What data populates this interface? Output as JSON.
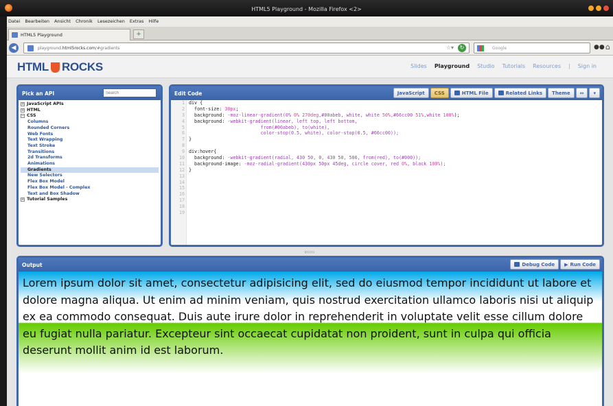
{
  "browser": {
    "title": "HTML5 Playground - Mozilla Firefox <2>",
    "menu": [
      "Datei",
      "Bearbeiten",
      "Ansicht",
      "Chronik",
      "Lesezeichen",
      "Extras",
      "Hilfe"
    ],
    "tab_title": "HTML5 Playground",
    "new_tab_label": "+",
    "url_domain_plain": "playground.",
    "url_domain_bold": "html5rocks.com",
    "url_path": "/#gradients",
    "search_placeholder": "Google"
  },
  "site": {
    "logo_left": "HTML",
    "logo_right": "ROCKS",
    "nav": [
      "Slides",
      "Playground",
      "Studio",
      "Tutorials",
      "Resources",
      "Sign in"
    ],
    "nav_active": "Playground"
  },
  "api_panel": {
    "title": "Pick an API",
    "search_placeholder": "Search",
    "items": [
      {
        "label": "JavaScript APIs",
        "level": 0,
        "expander": "+"
      },
      {
        "label": "HTML",
        "level": 0,
        "expander": "+"
      },
      {
        "label": "CSS",
        "level": 0,
        "expander": "−"
      },
      {
        "label": "Columns",
        "level": 1
      },
      {
        "label": "Rounded Corners",
        "level": 1
      },
      {
        "label": "Web Fonts",
        "level": 1
      },
      {
        "label": "Text Wrapping",
        "level": 1
      },
      {
        "label": "Text Stroke",
        "level": 1
      },
      {
        "label": "Transitions",
        "level": 1
      },
      {
        "label": "2d Transforms",
        "level": 1
      },
      {
        "label": "Animations",
        "level": 1
      },
      {
        "label": "Gradients",
        "level": 1,
        "selected": true
      },
      {
        "label": "New Selectors",
        "level": 1
      },
      {
        "label": "Flex Box Model",
        "level": 1
      },
      {
        "label": "Flex Box Model - Complex",
        "level": 1
      },
      {
        "label": "Text and Box Shadow",
        "level": 1
      },
      {
        "label": "Tutorial Samples",
        "level": 0,
        "expander": "+"
      }
    ]
  },
  "code_panel": {
    "title": "Edit Code",
    "buttons": {
      "javascript": "JavaScript",
      "css": "CSS",
      "html_file": "HTML File",
      "related_links": "Related Links",
      "theme": "Theme",
      "more": "↔",
      "menu": "▾"
    },
    "active_button": "CSS",
    "lines": [
      [
        {
          "t": "div {",
          "c": "k"
        }
      ],
      [
        {
          "t": "  font-size: ",
          "c": "k"
        },
        {
          "t": "30px",
          "c": "n"
        },
        {
          "t": ";",
          "c": "k"
        }
      ],
      [
        {
          "t": "  background: ",
          "c": "k"
        },
        {
          "t": "-moz-linear-gradient(0% ",
          "c": "v"
        },
        {
          "t": "0% 270deg",
          "c": "n"
        },
        {
          "t": ",#00abeb, white, white ",
          "c": "v"
        },
        {
          "t": "50%",
          "c": "n"
        },
        {
          "t": ",#66cc00 ",
          "c": "v"
        },
        {
          "t": "51%",
          "c": "n"
        },
        {
          "t": ",white ",
          "c": "v"
        },
        {
          "t": "100%",
          "c": "n"
        },
        {
          "t": ");",
          "c": "k"
        }
      ],
      [
        {
          "t": "  background: ",
          "c": "k"
        },
        {
          "t": "-webkit-gradient(linear, left top, left bottom,",
          "c": "v"
        }
      ],
      [
        {
          "t": "                          from(#00abeb), to(white),",
          "c": "v"
        }
      ],
      [
        {
          "t": "                          color-stop(0.5, white), color-stop(0.5, #66cc00));",
          "c": "v"
        }
      ],
      [
        {
          "t": "}",
          "c": "k"
        }
      ],
      [
        {
          "t": "",
          "c": "k"
        }
      ],
      [
        {
          "t": "div:hover{",
          "c": "k"
        }
      ],
      [
        {
          "t": "  background: ",
          "c": "k"
        },
        {
          "t": "-webkit-gradient(radial, 430 50, 0, 430 50, 506, from(red), to(#000));",
          "c": "v"
        }
      ],
      [
        {
          "t": "  background-image: ",
          "c": "k"
        },
        {
          "t": "-moz-radial-gradient(430px 50px 45deg, circle cover, red ",
          "c": "v"
        },
        {
          "t": "0%",
          "c": "n"
        },
        {
          "t": ", black ",
          "c": "v"
        },
        {
          "t": "100%",
          "c": "n"
        },
        {
          "t": ");",
          "c": "v"
        }
      ],
      [
        {
          "t": "}",
          "c": "k"
        }
      ],
      [],
      [],
      [],
      [],
      [],
      [],
      []
    ]
  },
  "output_panel": {
    "title": "Output",
    "debug_label": "Debug Code",
    "run_label": "Run Code",
    "lorem": "Lorem ipsum dolor sit amet, consectetur adipisicing elit, sed do eiusmod tempor incididunt ut labore et dolore magna aliqua. Ut enim ad minim veniam, quis nostrud exercitation ullamco laboris nisi ut aliquip ex ea commodo consequat. Duis aute irure dolor in reprehenderit in voluptate velit esse cillum dolore eu fugiat nulla pariatur. Excepteur sint occaecat cupidatat non proident, sunt in culpa qui officia deserunt mollit anim id est laborum."
  },
  "colors": {
    "panel_blue": "#4068ad",
    "gradient_top": "#00abeb",
    "gradient_bottom_band": "#66cc00",
    "css_button_active": "#e3c06b"
  },
  "icons": {
    "back": "back-arrow-icon",
    "reload": "reload-icon",
    "bookmark": "star-icon",
    "home": "home-icon",
    "search_provider": "google-icon",
    "html_file": "file-icon",
    "related_links": "links-icon",
    "debug": "debug-icon",
    "run": "play-icon"
  }
}
